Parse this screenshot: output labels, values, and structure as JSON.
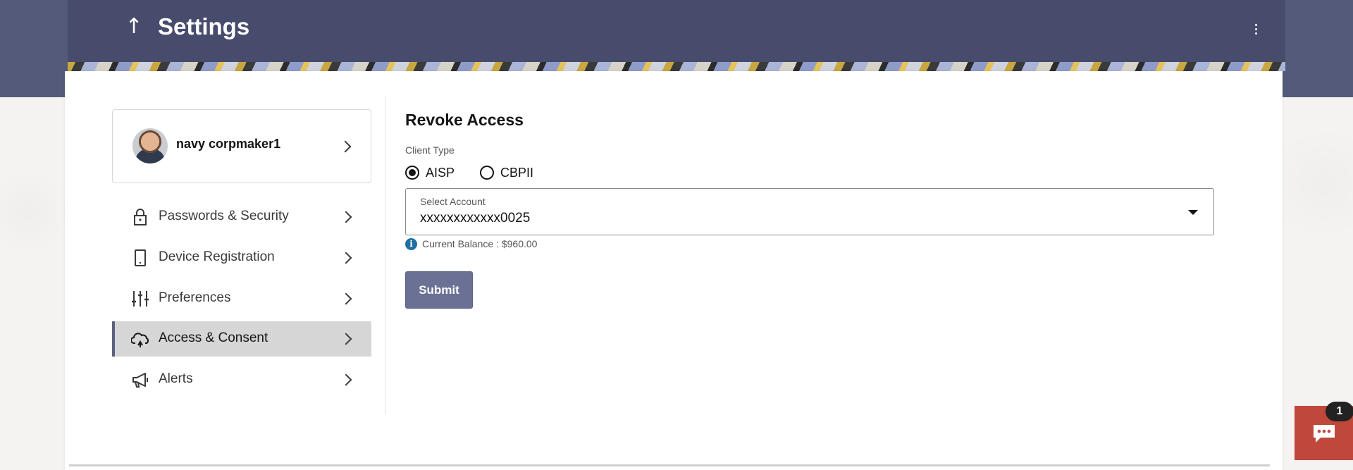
{
  "header": {
    "title": "Settings",
    "back_icon": "up-arrow-icon",
    "menu_icon": "kebab-menu-icon"
  },
  "sidebar": {
    "profile": {
      "name": "navy corpmaker1"
    },
    "items": [
      {
        "label": "Passwords & Security",
        "icon": "lock-icon",
        "active": false
      },
      {
        "label": "Device Registration",
        "icon": "tablet-icon",
        "active": false
      },
      {
        "label": "Preferences",
        "icon": "sliders-icon",
        "active": false
      },
      {
        "label": "Access & Consent",
        "icon": "cloud-icon",
        "active": true
      },
      {
        "label": "Alerts",
        "icon": "megaphone-icon",
        "active": false
      }
    ]
  },
  "main": {
    "title": "Revoke Access",
    "client_type_label": "Client Type",
    "client_types": [
      {
        "label": "AISP",
        "checked": true
      },
      {
        "label": "CBPII",
        "checked": false
      }
    ],
    "select_account": {
      "label": "Select Account",
      "value": "xxxxxxxxxxxx0025"
    },
    "balance_text": "Current Balance : $960.00",
    "submit_label": "Submit"
  },
  "chat": {
    "badge_count": "1",
    "icon": "chat-icon"
  },
  "colors": {
    "header": "#474b6c",
    "accent": "#5b6180",
    "button": "#6a7194",
    "chat": "#c0473b",
    "info": "#1f6fa3"
  }
}
